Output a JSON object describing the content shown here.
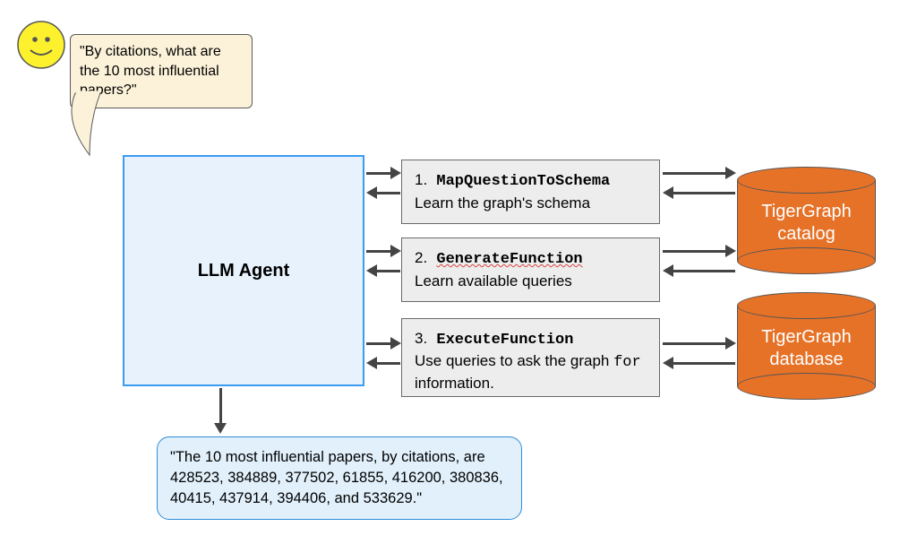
{
  "user_question": "\"By citations, what are the 10 most influential papers?\"",
  "agent": {
    "label": "LLM Agent"
  },
  "tools": [
    {
      "index": "1.",
      "name": "MapQuestionToSchema",
      "desc": "Learn the graph's schema"
    },
    {
      "index": "2.",
      "name": "GenerateFunction",
      "desc": "Learn available queries"
    },
    {
      "index": "3.",
      "name": "ExecuteFunction",
      "desc_pre": "Use queries to ask the graph ",
      "desc_mono": "for",
      "desc_post": " information."
    }
  ],
  "databases": [
    {
      "line1": "TigerGraph",
      "line2": "catalog"
    },
    {
      "line1": "TigerGraph",
      "line2": "database"
    }
  ],
  "output": "\"The 10 most influential papers, by citations, are 428523, 384889, 377502, 61855, 416200, 380836, 40415, 437914, 394406, and 533629.\""
}
